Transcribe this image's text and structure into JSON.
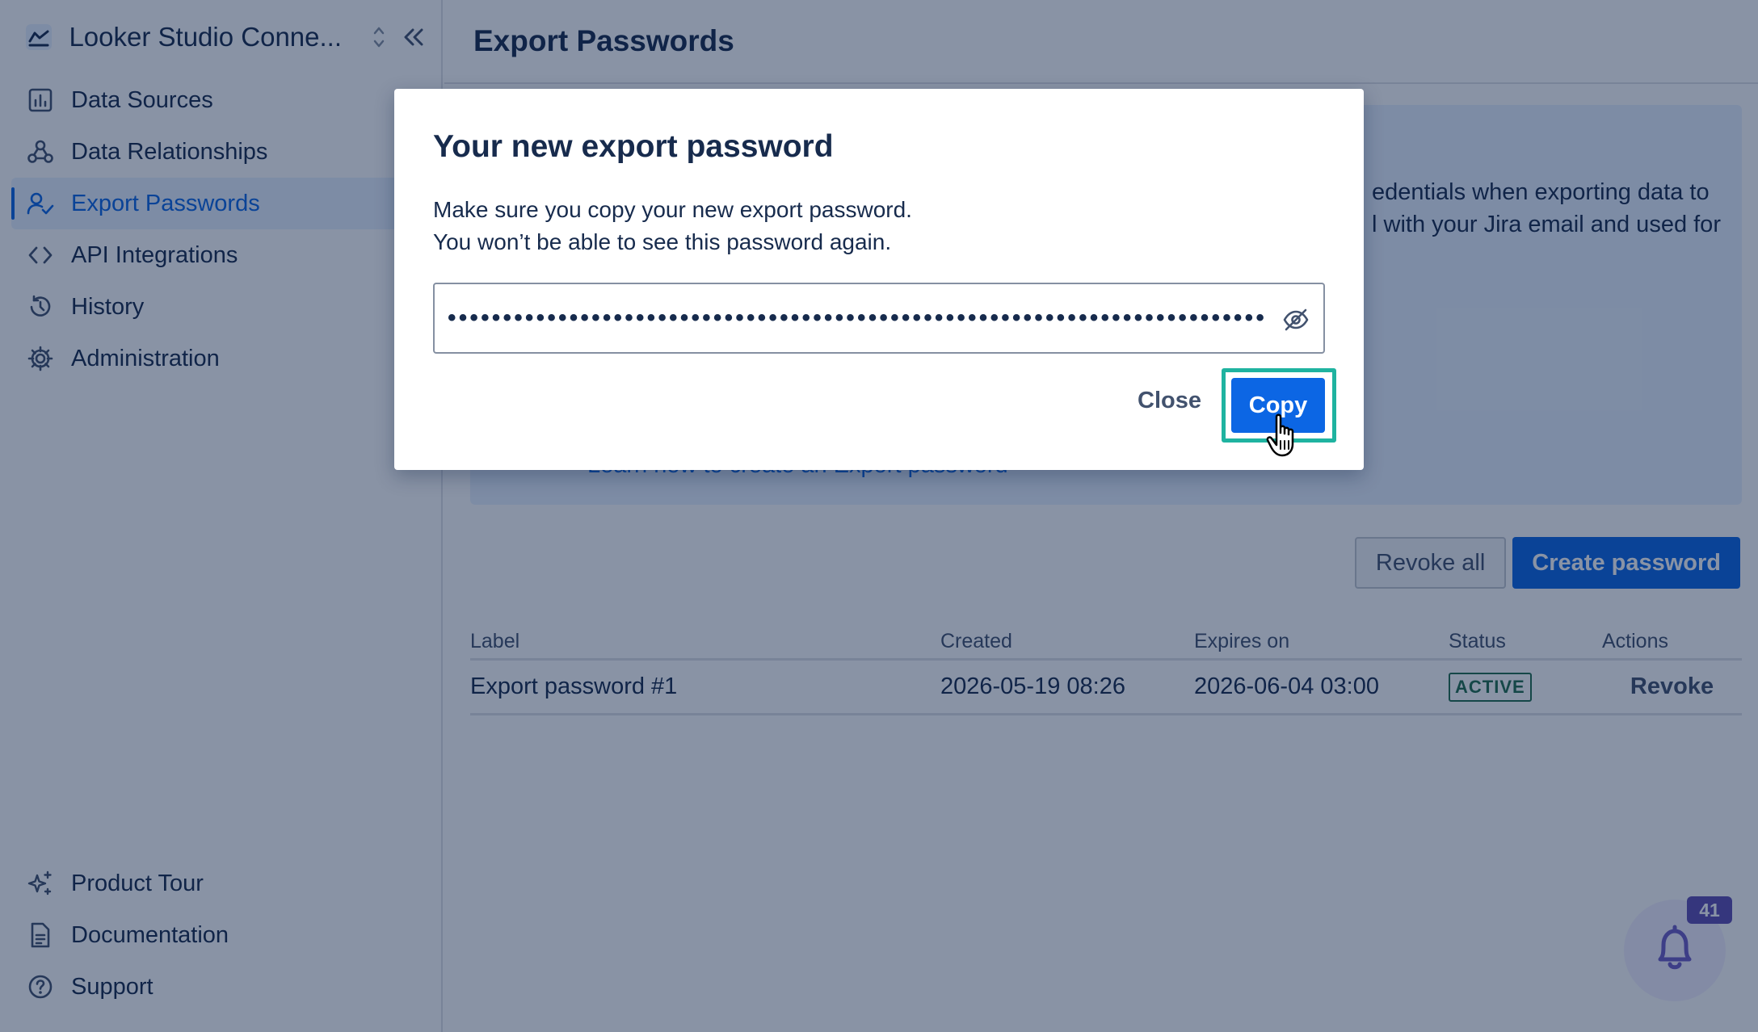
{
  "sidebar": {
    "app_title": "Looker Studio Conne...",
    "items": [
      {
        "label": "Data Sources",
        "icon": "bar-chart-icon"
      },
      {
        "label": "Data Relationships",
        "icon": "relationship-icon"
      },
      {
        "label": "Export Passwords",
        "icon": "user-check-icon",
        "active": true
      },
      {
        "label": "API Integrations",
        "icon": "code-icon"
      },
      {
        "label": "History",
        "icon": "history-icon"
      },
      {
        "label": "Administration",
        "icon": "gear-icon"
      }
    ],
    "bottom_items": [
      {
        "label": "Product Tour",
        "icon": "sparkle-icon"
      },
      {
        "label": "Documentation",
        "icon": "document-icon"
      },
      {
        "label": "Support",
        "icon": "help-icon"
      }
    ]
  },
  "main": {
    "page_title": "Export Passwords",
    "info_text_line1": "edentials when exporting data to",
    "info_text_line2": "l with your Jira email and used for",
    "info_link": "Learn how to create an Export password",
    "buttons": {
      "revoke_all": "Revoke all",
      "create": "Create password"
    },
    "table": {
      "headers": [
        "Label",
        "Created",
        "Expires on",
        "Status",
        "Actions"
      ],
      "rows": [
        {
          "label": "Export password #1",
          "created": "2026-05-19 08:26",
          "expires": "2026-06-04 03:00",
          "status": "ACTIVE",
          "action": "Revoke"
        }
      ]
    },
    "notifications_count": "41"
  },
  "modal": {
    "title": "Your new export password",
    "desc_line1": "Make sure you copy your new export password.",
    "desc_line2": "You won’t be able to see this password again.",
    "password_mask": "•••••••••••••••••••••••••••••••••••••••••••••••••••••••••••••••••••••••••••••",
    "close_label": "Close",
    "copy_label": "Copy"
  },
  "colors": {
    "accent": "#0c66e4",
    "highlight": "#1fb3a0",
    "status_active": "#216e4e",
    "notification_badge": "#5e4db2"
  }
}
